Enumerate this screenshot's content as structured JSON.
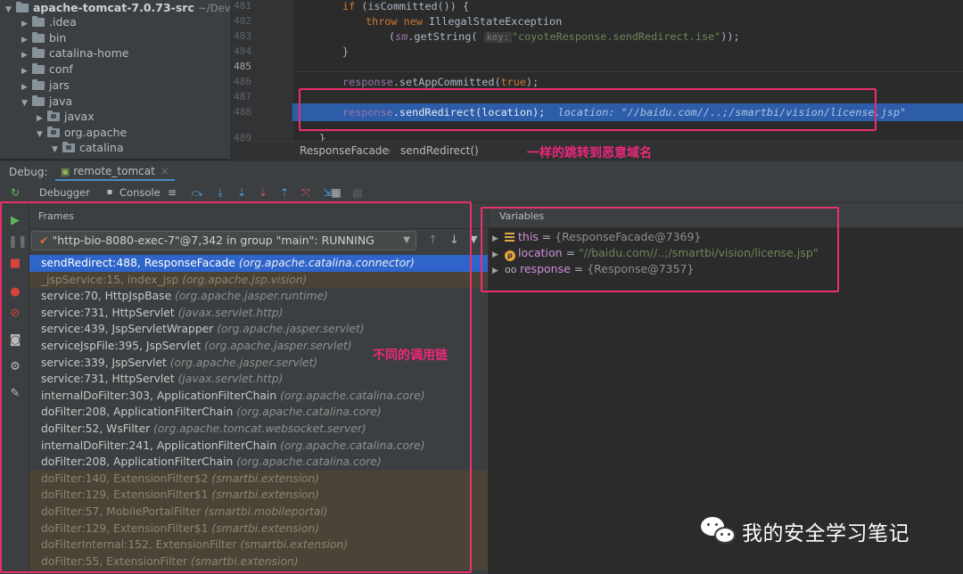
{
  "project_tree": {
    "root_name": "apache-tomcat-7.0.73-src",
    "root_hint": "~/DevTo",
    "items": [
      {
        "label": ".idea"
      },
      {
        "label": "bin"
      },
      {
        "label": "catalina-home"
      },
      {
        "label": "conf"
      },
      {
        "label": "jars"
      },
      {
        "label": "java"
      },
      {
        "label": "javax"
      },
      {
        "label": "org.apache"
      },
      {
        "label": "catalina"
      }
    ]
  },
  "editor": {
    "line_numbers": [
      "481",
      "482",
      "483",
      "484",
      "485",
      "486",
      "487",
      "488",
      "489"
    ],
    "code": {
      "l481_kw": "if",
      "l481_rest": " (isCommitted()) {",
      "l482_kw1": "throw",
      "l482_kw2": "new",
      "l482_rest": " IllegalStateException",
      "l483_open": "(",
      "l483_sm": "sm",
      "l483_call": ".getString(",
      "l483_hint": "key:",
      "l483_str": "\"coyoteResponse.sendRedirect.ise\"",
      "l483_close": "));",
      "l484": "}",
      "l486_obj": "response",
      "l486_call": ".setAppCommitted(",
      "l486_kw": "true",
      "l486_close": ");",
      "l488_obj": "response",
      "l488_call": ".sendRedirect(location);",
      "l488_inline": "location: \"//baidu.com//..;/smartbi/vision/license.jsp\"",
      "l489": "}"
    },
    "breadcrumb": [
      "ResponseFacade",
      "›",
      "sendRedirect()"
    ]
  },
  "debug": {
    "label": "Debug:",
    "session_tab": "remote_tomcat",
    "session_close": "×",
    "toolbar_tabs": [
      "Debugger",
      "Console"
    ]
  },
  "frames": {
    "tab_label": "Frames",
    "thread": "\"http-bio-8080-exec-7\"@7,342 in group \"main\": RUNNING",
    "rows": [
      {
        "method": "sendRedirect:488, ResponseFacade",
        "pkg": "(org.apache.catalina.connector)",
        "style": "sel"
      },
      {
        "method": "_jspService:15, index_jsp",
        "pkg": "(org.apache.jsp.vision)",
        "style": "lib"
      },
      {
        "method": "service:70, HttpJspBase",
        "pkg": "(org.apache.jasper.runtime)",
        "style": ""
      },
      {
        "method": "service:731, HttpServlet",
        "pkg": "(javax.servlet.http)",
        "style": ""
      },
      {
        "method": "service:439, JspServletWrapper",
        "pkg": "(org.apache.jasper.servlet)",
        "style": ""
      },
      {
        "method": "serviceJspFile:395, JspServlet",
        "pkg": "(org.apache.jasper.servlet)",
        "style": ""
      },
      {
        "method": "service:339, JspServlet",
        "pkg": "(org.apache.jasper.servlet)",
        "style": ""
      },
      {
        "method": "service:731, HttpServlet",
        "pkg": "(javax.servlet.http)",
        "style": ""
      },
      {
        "method": "internalDoFilter:303, ApplicationFilterChain",
        "pkg": "(org.apache.catalina.core)",
        "style": ""
      },
      {
        "method": "doFilter:208, ApplicationFilterChain",
        "pkg": "(org.apache.catalina.core)",
        "style": ""
      },
      {
        "method": "doFilter:52, WsFilter",
        "pkg": "(org.apache.tomcat.websocket.server)",
        "style": ""
      },
      {
        "method": "internalDoFilter:241, ApplicationFilterChain",
        "pkg": "(org.apache.catalina.core)",
        "style": ""
      },
      {
        "method": "doFilter:208, ApplicationFilterChain",
        "pkg": "(org.apache.catalina.core)",
        "style": ""
      },
      {
        "method": "doFilter:140, ExtensionFilter$2",
        "pkg": "(smartbi.extension)",
        "style": "lib"
      },
      {
        "method": "doFilter:129, ExtensionFilter$1",
        "pkg": "(smartbi.extension)",
        "style": "lib"
      },
      {
        "method": "doFilter:57, MobilePortalFilter",
        "pkg": "(smartbi.mobileportal)",
        "style": "lib"
      },
      {
        "method": "doFilter:129, ExtensionFilter$1",
        "pkg": "(smartbi.extension)",
        "style": "lib"
      },
      {
        "method": "doFilterInternal:152, ExtensionFilter",
        "pkg": "(smartbi.extension)",
        "style": "lib"
      },
      {
        "method": "doFilter:55, ExtensionFilter",
        "pkg": "(smartbi.extension)",
        "style": "lib"
      }
    ]
  },
  "variables": {
    "tab_label": "Variables",
    "rows": [
      {
        "name": "this",
        "eq": " = ",
        "value": "{ResponseFacade@7369}",
        "kind": "obj"
      },
      {
        "name": "location",
        "eq": " = ",
        "value": "\"//baidu.com//..;/smartbi/vision/license.jsp\"",
        "kind": "str"
      },
      {
        "name": "response",
        "eq": " = ",
        "value": "{Response@7357}",
        "kind": "obj"
      }
    ]
  },
  "annotations": {
    "redirect_note": "一样的跳转到恶意域名",
    "chain_note": "不同的调用链"
  },
  "watermark": {
    "text": "我的安全学习笔记"
  },
  "colors": {
    "accent_red": "#e8306a",
    "selection_blue": "#2f65ca",
    "editor_highlight": "#2d5ca8"
  }
}
